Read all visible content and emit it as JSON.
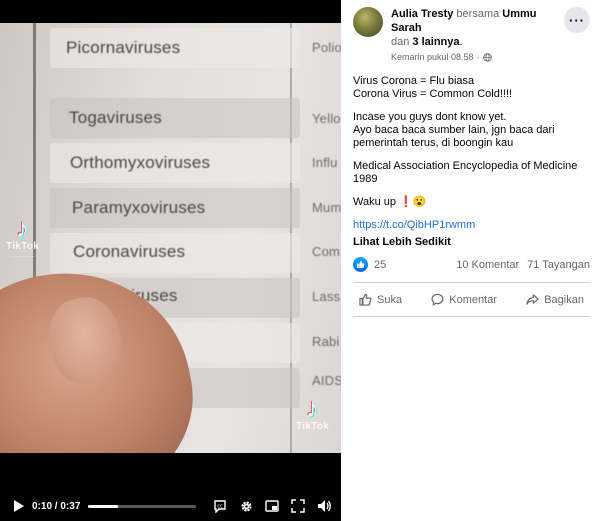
{
  "video": {
    "frame_rows": [
      {
        "left": "Picornaviruses",
        "right": "Polio, infec"
      },
      {
        "left": "Togaviruses",
        "right": "Yello"
      },
      {
        "left": "Orthomyxoviruses",
        "right": "Influ"
      },
      {
        "left": "Paramyxoviruses",
        "right": "Mum"
      },
      {
        "left": "Coronaviruses",
        "right": "Com"
      },
      {
        "left": "Arenaviruses",
        "right": "Lass"
      },
      {
        "left": "",
        "right": "Rabi"
      },
      {
        "left": "",
        "right": "AIDS"
      }
    ],
    "watermark_word": "TikTok",
    "controls": {
      "time_current": "0:10",
      "time_total": "0:37",
      "progress": 0.27,
      "icons": [
        "play-icon",
        "captions-icon",
        "settings-icon",
        "pip-icon",
        "fullscreen-icon",
        "volume-icon"
      ]
    }
  },
  "post": {
    "author": "Aulia Tresty",
    "with_word": "bersama",
    "tagged": "Ummu Sarah",
    "and_word": "dan",
    "others": "3 lainnya",
    "timestamp": "Kemarin pukul 08.58",
    "privacy_sep": "·",
    "more_label": "···",
    "lines": [
      [
        "Virus Corona = Flu biasa",
        "Corona Virus = Common Cold!!!!"
      ],
      [
        "Incase you guys dont know yet.",
        "Ayo baca baca sumber lain, jgn baca dari pemerintah terus, di boongin kau"
      ],
      [
        "Medical Association Encyclopedia of Medicine 1989"
      ],
      [
        "Waku up ❗😮"
      ]
    ],
    "url": "https://t.co/QibHP1rwmm",
    "see_less": "Lihat Lebih Sedikit",
    "reactions_count": "25",
    "comments": "10 Komentar",
    "views": "71 Tayangan",
    "actions": {
      "like": "Suka",
      "comment": "Komentar",
      "share": "Bagikan"
    },
    "accent": "#216fdb"
  }
}
